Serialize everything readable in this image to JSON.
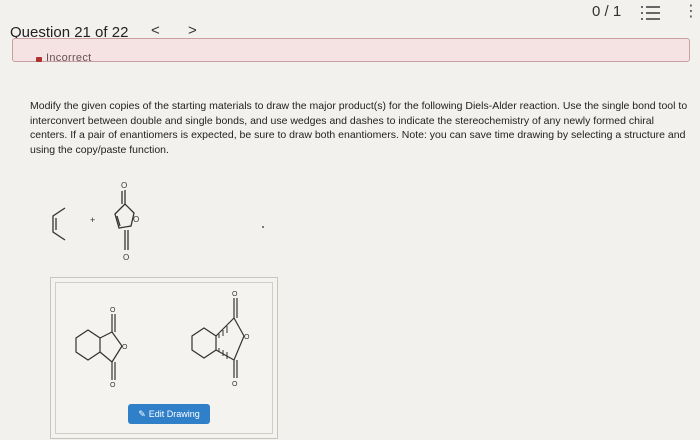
{
  "header": {
    "score": "0 / 1",
    "question_title": "Question 21 of 22",
    "prev_label": "<",
    "next_label": ">",
    "kebab_label": "⋮"
  },
  "feedback": {
    "status": "Incorrect"
  },
  "question": {
    "instructions": "Modify the given copies of the starting materials to draw the major product(s) for the following Diels-Alder reaction. Use the single bond tool to interconvert between double and single bonds, and use wedges and dashes to indicate the stereochemistry of any newly formed chiral centers. If a pair of enantiomers is expected, be sure to draw both enantiomers. Note: you can save time drawing by selecting a structure and using the copy/paste function.",
    "plus_sign": "+",
    "atom_label": "O"
  },
  "drawing": {
    "edit_button_label": "Edit Drawing",
    "edit_icon": "pencil-icon"
  },
  "colors": {
    "accent": "#2f7fc9",
    "incorrect": "#b03030"
  }
}
